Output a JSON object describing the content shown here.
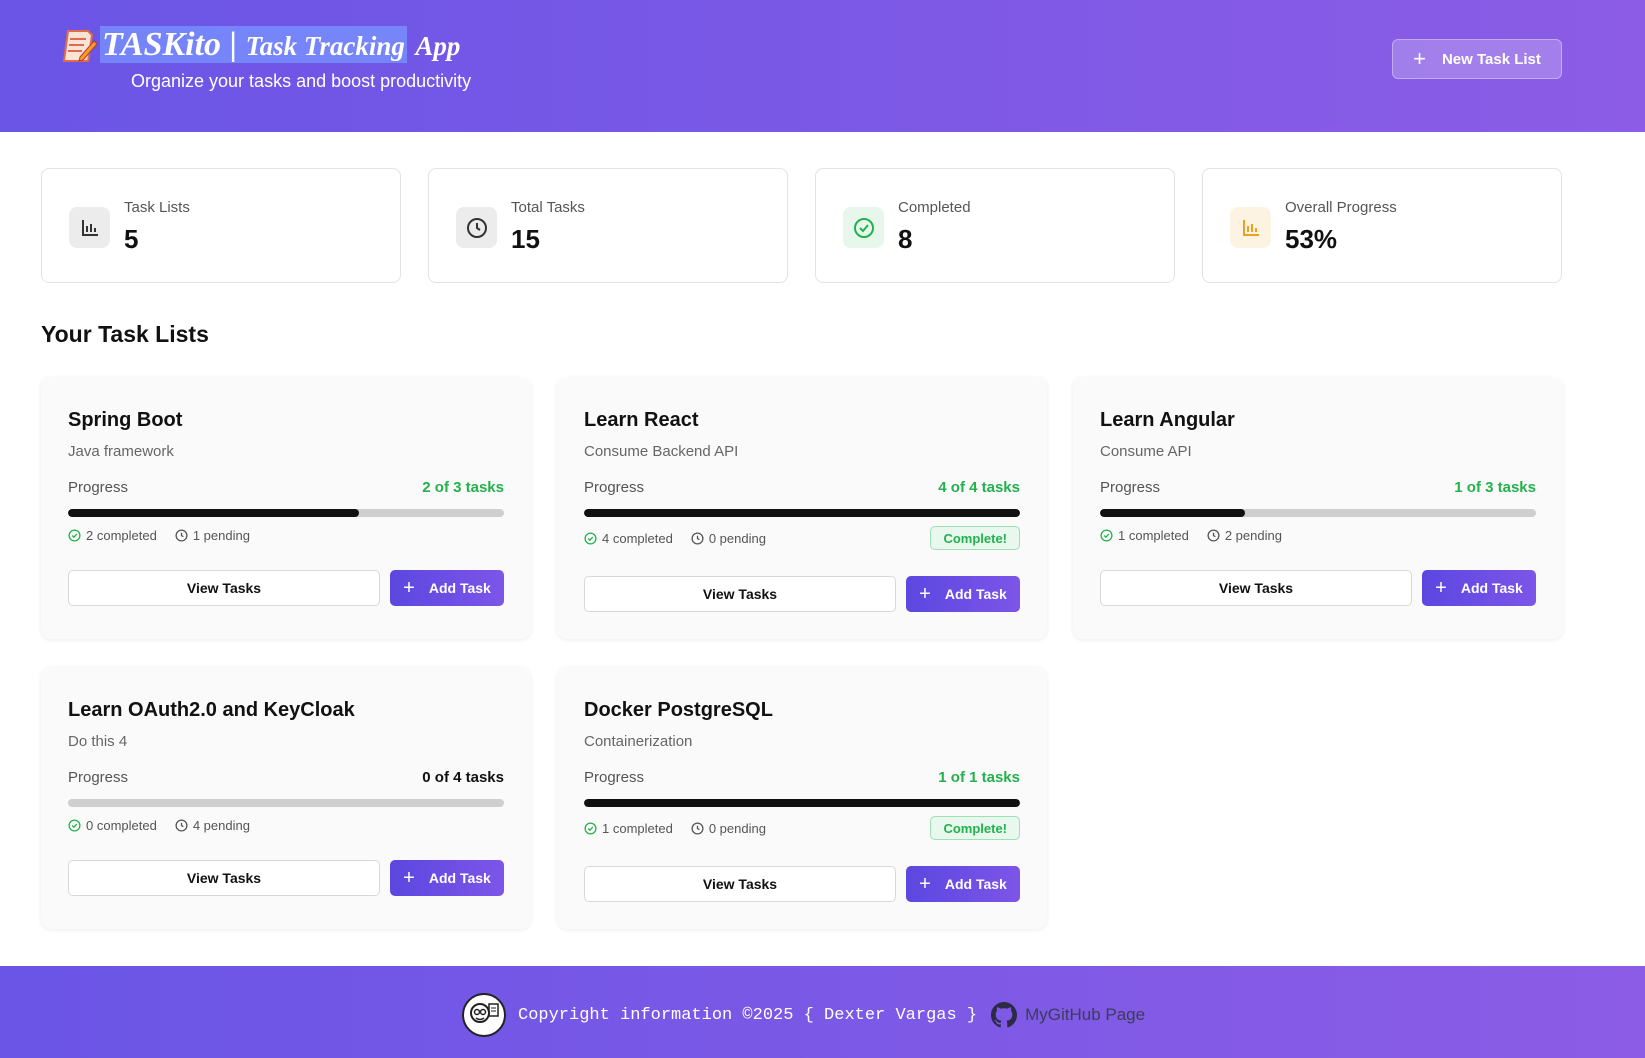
{
  "header": {
    "brand_name": "TASKito",
    "brand_separator": "|",
    "brand_highlight": "Task Tracking",
    "brand_suffix": "App",
    "subtitle": "Organize your tasks and boost productivity",
    "new_list_label": "New Task List"
  },
  "stats": [
    {
      "label": "Task Lists",
      "value": "5",
      "icon": "bar-chart-icon"
    },
    {
      "label": "Total Tasks",
      "value": "15",
      "icon": "clock-icon"
    },
    {
      "label": "Completed",
      "value": "8",
      "icon": "check-circle-icon"
    },
    {
      "label": "Overall Progress",
      "value": "53%",
      "icon": "bar-chart-icon"
    }
  ],
  "section_title": "Your Task Lists",
  "task_lists": [
    {
      "title": "Spring Boot",
      "description": "Java framework",
      "progress_label": "Progress",
      "count_text": "2 of 3 tasks",
      "progress": 0.667,
      "completed_text": "2 completed",
      "pending_text": "1 pending",
      "complete_badge": "",
      "view_label": "View Tasks",
      "add_label": "Add Task"
    },
    {
      "title": "Learn React",
      "description": "Consume Backend API",
      "progress_label": "Progress",
      "count_text": "4 of 4 tasks",
      "progress": 1.0,
      "completed_text": "4 completed",
      "pending_text": "0 pending",
      "complete_badge": "Complete!",
      "view_label": "View Tasks",
      "add_label": "Add Task"
    },
    {
      "title": "Learn Angular",
      "description": "Consume API",
      "progress_label": "Progress",
      "count_text": "1 of 3 tasks",
      "progress": 0.333,
      "completed_text": "1 completed",
      "pending_text": "2 pending",
      "complete_badge": "",
      "view_label": "View Tasks",
      "add_label": "Add Task"
    },
    {
      "title": "Learn OAuth2.0 and KeyCloak",
      "description": "Do this 4",
      "progress_label": "Progress",
      "count_text": "0 of 4 tasks",
      "progress": 0.0,
      "completed_text": "0 completed",
      "pending_text": "4 pending",
      "complete_badge": "",
      "view_label": "View Tasks",
      "add_label": "Add Task"
    },
    {
      "title": "Docker PostgreSQL",
      "description": "Containerization",
      "progress_label": "Progress",
      "count_text": "1 of 1 tasks",
      "progress": 1.0,
      "completed_text": "1 completed",
      "pending_text": "0 pending",
      "complete_badge": "Complete!",
      "view_label": "View Tasks",
      "add_label": "Add Task"
    }
  ],
  "footer": {
    "copyright": "Copyright information ©2025 { Dexter Vargas }",
    "github_label": "MyGitHub Page"
  },
  "colors": {
    "accent": "#6a55e6",
    "accent_end": "#8c5ce6",
    "success": "#22b14c",
    "progress_fill": "#111111"
  }
}
